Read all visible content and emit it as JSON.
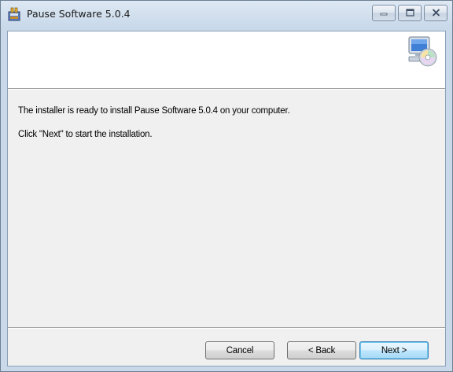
{
  "window": {
    "title": "Pause Software 5.0.4",
    "app_icon": "installer-icon",
    "controls": {
      "minimize_icon": "minimize-icon",
      "maximize_icon": "maximize-icon",
      "close_icon": "close-icon"
    }
  },
  "banner": {
    "icon": "computer-cd-icon"
  },
  "body": {
    "line1": "The installer is ready to install Pause Software 5.0.4 on your computer.",
    "line2": "Click \"Next\" to start the installation."
  },
  "buttons": {
    "cancel": "Cancel",
    "back": "< Back",
    "next": "Next >"
  }
}
